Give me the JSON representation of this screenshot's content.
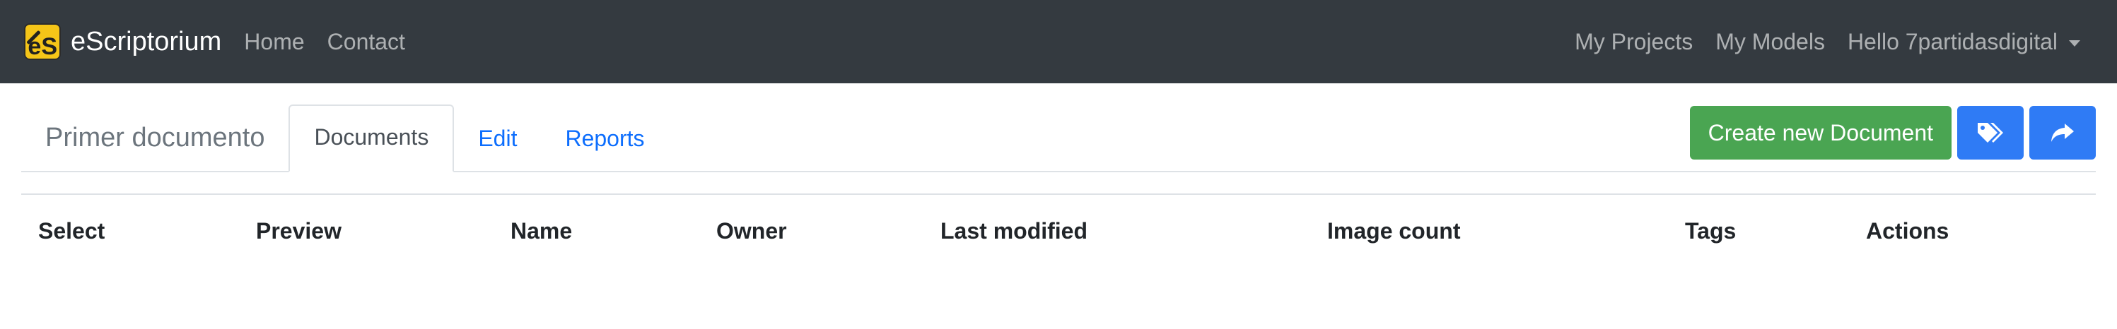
{
  "navbar": {
    "brand": "eScriptorium",
    "logo_text": "eS",
    "links": [
      "Home",
      "Contact"
    ],
    "right_links": [
      "My Projects",
      "My Models"
    ],
    "user_menu": "Hello 7partidasdigital"
  },
  "project": {
    "title": "Primer documento",
    "tabs": [
      "Documents",
      "Edit",
      "Reports"
    ],
    "active_tab": "Documents"
  },
  "actions": {
    "create_label": "Create new Document",
    "tags_icon": "tags-icon",
    "share_icon": "share-icon"
  },
  "table": {
    "headers": [
      "Select",
      "Preview",
      "Name",
      "Owner",
      "Last modified",
      "Image count",
      "Tags",
      "Actions"
    ],
    "rows": []
  },
  "colors": {
    "navbar_bg": "#343a40",
    "success": "#4aa552",
    "primary": "#2f7bf5",
    "link": "#0d6efd"
  }
}
